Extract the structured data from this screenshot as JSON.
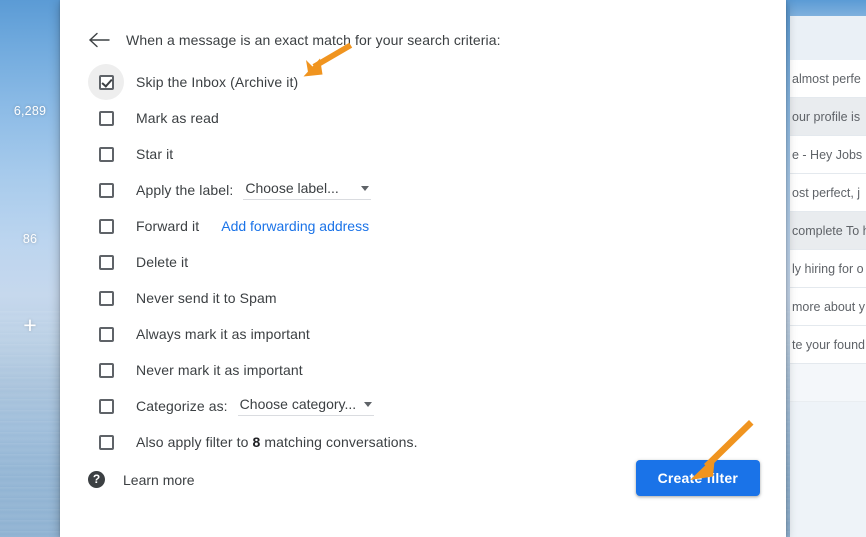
{
  "backdrop": {
    "rail": {
      "count_primary": "6,289",
      "count_secondary": "86",
      "add_icon_glyph": "+"
    },
    "mail_list": [
      {
        "snippet": "almost perfe",
        "unread": false
      },
      {
        "snippet": "our profile is ",
        "unread": true
      },
      {
        "snippet": "e - Hey Jobs",
        "unread": false
      },
      {
        "snippet": "ost perfect, j",
        "unread": false
      },
      {
        "snippet": "complete To h",
        "unread": true
      },
      {
        "snippet": "ly hiring for o",
        "unread": false
      },
      {
        "snippet": "more about y",
        "unread": false
      },
      {
        "snippet": "te your found",
        "unread": false
      }
    ]
  },
  "dialog": {
    "back_arrow_name": "back-arrow-icon",
    "title": "When a message is an exact match for your search criteria:",
    "options": [
      {
        "label": "Skip the Inbox (Archive it)",
        "checked": true,
        "active": true,
        "control": "none"
      },
      {
        "label": "Mark as read",
        "checked": false,
        "active": false,
        "control": "none"
      },
      {
        "label": "Star it",
        "checked": false,
        "active": false,
        "control": "none"
      },
      {
        "label": "Apply the label:",
        "checked": false,
        "active": false,
        "control": "select",
        "select_value": "Choose label..."
      },
      {
        "label": "Forward it",
        "checked": false,
        "active": false,
        "control": "link",
        "link_text": "Add forwarding address"
      },
      {
        "label": "Delete it",
        "checked": false,
        "active": false,
        "control": "none"
      },
      {
        "label": "Never send it to Spam",
        "checked": false,
        "active": false,
        "control": "none"
      },
      {
        "label": "Always mark it as important",
        "checked": false,
        "active": false,
        "control": "none"
      },
      {
        "label": "Never mark it as important",
        "checked": false,
        "active": false,
        "control": "none"
      },
      {
        "label": "Categorize as:",
        "checked": false,
        "active": false,
        "control": "select-narrow",
        "select_value": "Choose category..."
      },
      {
        "label_html": "Also apply filter to <b>8</b> matching conversations.",
        "checked": false,
        "active": false,
        "control": "none"
      }
    ],
    "footer": {
      "help_icon_glyph": "?",
      "learn_more_label": "Learn more",
      "create_filter_label": "Create filter"
    }
  },
  "annotations": {
    "arrow_color": "#f0941f",
    "arrow_1_target": "skip-the-inbox-checkbox-row",
    "arrow_2_target": "create-filter-button"
  },
  "colors": {
    "accent_blue": "#1a73e8",
    "link_blue": "#1a73e8",
    "text_primary": "#3c4043",
    "annotation_orange": "#f0941f"
  }
}
